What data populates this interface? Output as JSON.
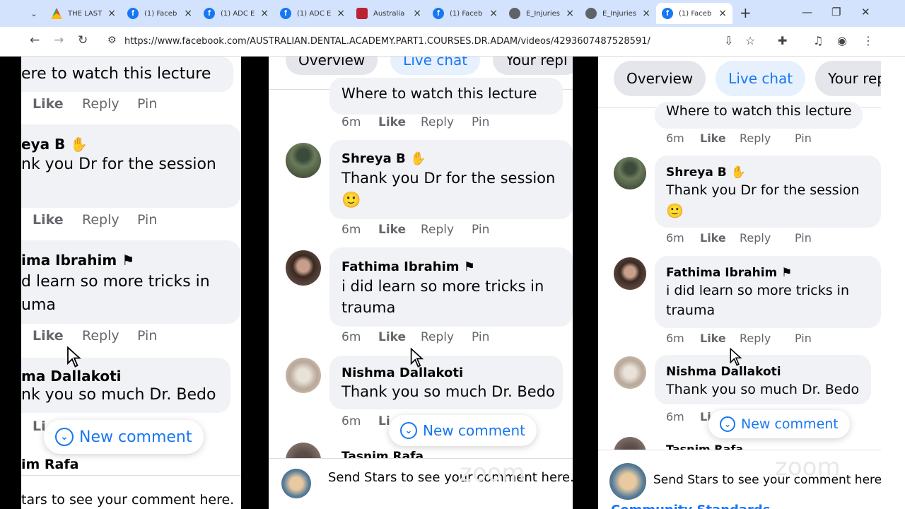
{
  "browser": {
    "tabs": [
      {
        "title": "THE LAST",
        "icon": "google-drive-icon"
      },
      {
        "title": "(1) Faceb",
        "icon": "facebook-icon"
      },
      {
        "title": "(1) ADC E",
        "icon": "facebook-icon"
      },
      {
        "title": "(1) ADC E",
        "icon": "facebook-icon"
      },
      {
        "title": "Australia",
        "icon": "site-icon"
      },
      {
        "title": "(1) Faceb",
        "icon": "facebook-icon"
      },
      {
        "title": "E_Injuries",
        "icon": "globe-icon"
      },
      {
        "title": "E_Injuries",
        "icon": "globe-icon"
      },
      {
        "title": "(1) Faceb",
        "icon": "facebook-icon"
      }
    ],
    "url": "https://www.facebook.com/AUSTRALIAN.DENTAL.ACADEMY.PART1.COURSES.DR.ADAM/videos/4293607487528591/"
  },
  "tabs": {
    "overview": "Overview",
    "live_chat": "Live chat",
    "your_replies": "Your repl",
    "your_replies_mid": "Your repl"
  },
  "comments": {
    "c0": {
      "text": "Where to watch this lecture",
      "text_p1": "ere to watch this lecture"
    },
    "c1": {
      "name": "Shreya B",
      "name_p1": "eya B",
      "text": "Thank you Dr for the session",
      "text_p1": "nk you Dr for the session",
      "emoji": "🙂"
    },
    "c2": {
      "name": "Fathima Ibrahim",
      "name_p1": "ima Ibrahim",
      "text1": "i did learn so more tricks in",
      "text1_p1": "d learn so more tricks in",
      "text2": "trauma",
      "text2_p1": "uma"
    },
    "c3": {
      "name": "Nishma Dallakoti",
      "name_p1": "ma Dallakoti",
      "text": "Thank you so much Dr. Bedo",
      "text_p1": "nk you so much Dr. Bedo"
    },
    "c4": {
      "name": "Tasnim Rafa",
      "name_p1": "im Rafa"
    }
  },
  "meta": {
    "time": "6m",
    "like": "Like",
    "reply": "Reply",
    "pin": "Pin",
    "like_cut": "Li"
  },
  "new_comment": "New comment",
  "send_stars": "Send Stars to see your comment here.",
  "send_stars_p1": "tars to see your comment here.",
  "community": "Community Standards",
  "zoom_watermark": "zoom"
}
